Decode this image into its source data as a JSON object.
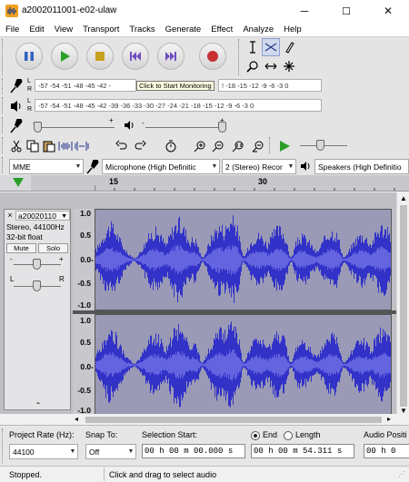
{
  "window": {
    "title": "a2002011001-e02-ulaw",
    "minimize": "─",
    "maximize": "☐",
    "close": "✕"
  },
  "menu": [
    "File",
    "Edit",
    "View",
    "Transport",
    "Tracks",
    "Generate",
    "Effect",
    "Analyze",
    "Help"
  ],
  "meters": {
    "record_letters": [
      "L",
      "R"
    ],
    "record_scale": "-57 -54 -51 -48 -45 -42 -",
    "record_tooltip": "Click to Start Monitoring",
    "record_scale_right": "! -18 -15 -12 -9 -6 -3 0",
    "playback_letters": [
      "L",
      "R"
    ],
    "playback_scale": "-57 -54 -51 -48 -45 -42 -39 -36 -33 -30 -27 -24 -21 -18 -15 -12 -9 -6 -3 0"
  },
  "mixer": {
    "rec_minus": "-",
    "rec_plus": "+",
    "play_minus": "-",
    "play_plus": "+"
  },
  "devices": {
    "host": "MME",
    "input": "Microphone (High Definitic",
    "channels": "2 (Stereo) Recor",
    "output": "Speakers (High Definitio"
  },
  "ruler": {
    "ticks": [
      "15",
      "30"
    ]
  },
  "track": {
    "name": "a20020110",
    "info1": "Stereo, 44100Hz",
    "info2": "32-bit float",
    "mute": "Mute",
    "solo": "Solo",
    "gain_minus": "-",
    "gain_plus": "+",
    "pan_left": "L",
    "pan_right": "R",
    "scale": [
      "1.0",
      "0.5",
      "0.0-",
      "-0.5",
      "-1.0"
    ]
  },
  "selection": {
    "project_rate_label": "Project Rate (Hz):",
    "project_rate_value": "44100",
    "snap_to_label": "Snap To:",
    "snap_to_value": "Off",
    "selection_start_label": "Selection Start:",
    "start_value": "00 h 00 m 00.000 s",
    "end_label": "End",
    "length_label": "Length",
    "end_value": "00 h 00 m 54.311 s",
    "audio_position_label": "Audio Positi",
    "audio_position_value": "00 h 0"
  },
  "status": {
    "state": "Stopped.",
    "hint": "Click and drag to select audio"
  },
  "colors": {
    "waveform": "#3232c8",
    "wave_background": "#9a9ab6",
    "play_green": "#2aa02a",
    "record_red": "#c83030",
    "transport_blue": "#3060c0"
  }
}
